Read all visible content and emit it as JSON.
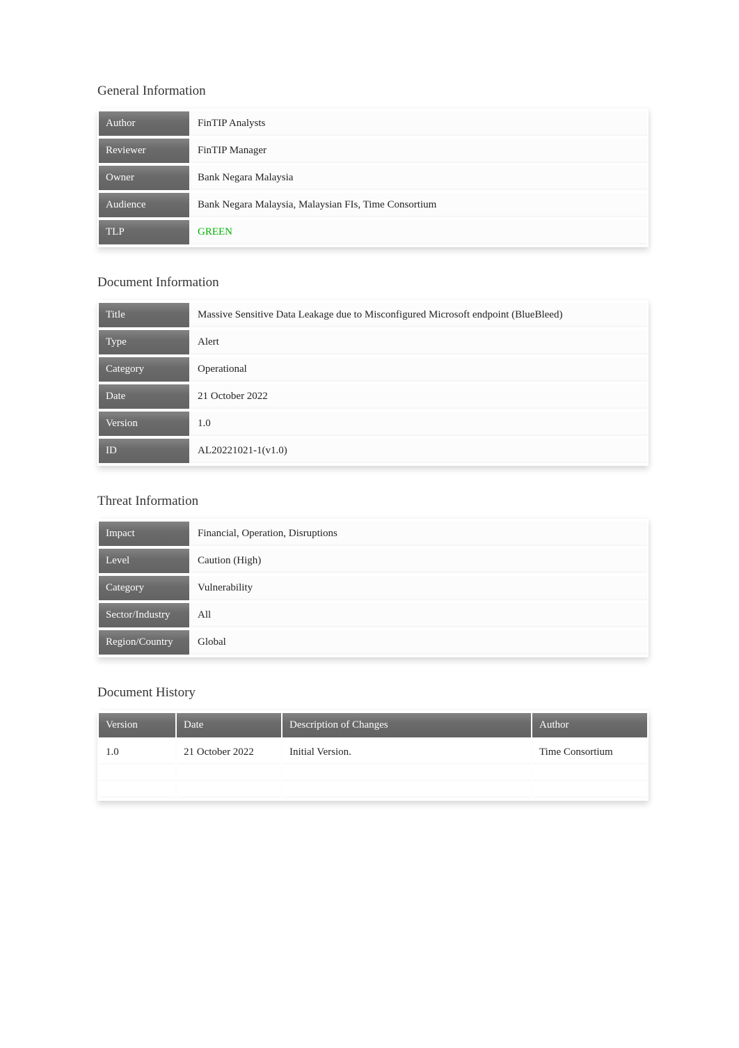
{
  "sections": {
    "general_heading": "General Information",
    "document_heading": "Document Information",
    "threat_heading": "Threat Information",
    "history_heading": "Document History"
  },
  "general": {
    "author_label": "Author",
    "author_value": "FinTIP Analysts",
    "reviewer_label": "Reviewer",
    "reviewer_value": "FinTIP Manager",
    "owner_label": "Owner",
    "owner_value": "Bank Negara Malaysia",
    "audience_label": "Audience",
    "audience_value": "Bank Negara Malaysia, Malaysian FIs, Time Consortium",
    "tlp_label": "TLP",
    "tlp_value": "GREEN"
  },
  "documentinfo": {
    "title_label": "Title",
    "title_value": "Massive Sensitive Data Leakage due to Misconfigured Microsoft endpoint (BlueBleed)",
    "type_label": "Type",
    "type_value": "Alert",
    "category_label": "Category",
    "category_value": "Operational",
    "date_label": "Date",
    "date_value": "21 October 2022",
    "version_label": "Version",
    "version_value": "1.0",
    "id_label": "ID",
    "id_value": "AL20221021-1(v1.0)"
  },
  "threat": {
    "impact_label": "Impact",
    "impact_value": "Financial, Operation, Disruptions",
    "level_label": "Level",
    "level_value": "Caution (High)",
    "category_label": "Category",
    "category_value": "Vulnerability",
    "sector_label": "Sector/Industry",
    "sector_value": "All",
    "region_label": "Region/Country",
    "region_value": "Global"
  },
  "history": {
    "headers": {
      "version": "Version",
      "date": "Date",
      "description": "Description of Changes",
      "author": "Author"
    },
    "rows": [
      {
        "version": "1.0",
        "date": "21 October 2022",
        "description": "Initial Version.",
        "author": "Time Consortium"
      },
      {
        "version": "",
        "date": "",
        "description": "",
        "author": ""
      },
      {
        "version": "",
        "date": "",
        "description": "",
        "author": ""
      }
    ]
  }
}
